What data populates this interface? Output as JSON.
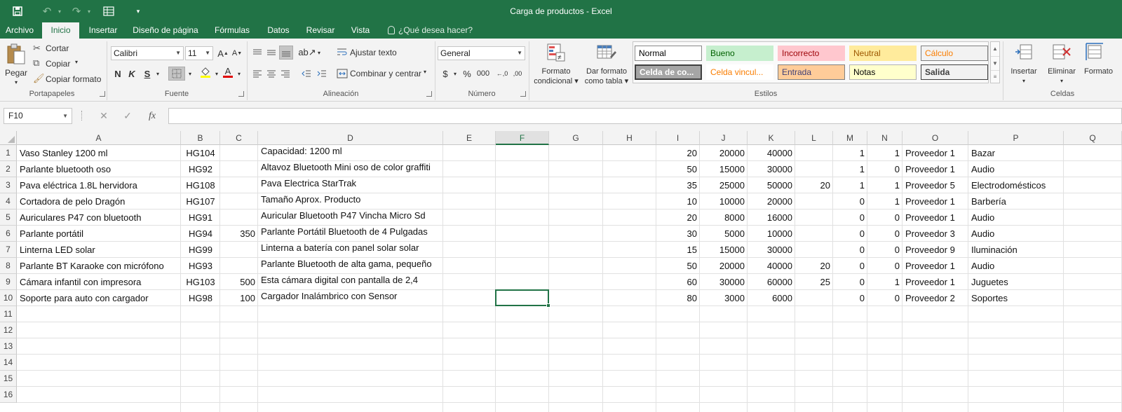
{
  "window_title": "Carga de productos - Excel",
  "quick_access": {
    "save_icon": "save-icon",
    "undo_icon": "undo-icon",
    "redo_icon": "redo-icon",
    "form_icon": "form-icon",
    "customize_icon": "customize-qat-icon"
  },
  "tabs": [
    {
      "label": "Archivo",
      "active": false
    },
    {
      "label": "Inicio",
      "active": true
    },
    {
      "label": "Insertar",
      "active": false
    },
    {
      "label": "Diseño de página",
      "active": false
    },
    {
      "label": "Fórmulas",
      "active": false
    },
    {
      "label": "Datos",
      "active": false
    },
    {
      "label": "Revisar",
      "active": false
    },
    {
      "label": "Vista",
      "active": false
    }
  ],
  "tell_me": "¿Qué desea hacer?",
  "ribbon": {
    "clipboard": {
      "paste": "Pegar",
      "cut": "Cortar",
      "copy": "Copiar",
      "format_painter": "Copiar formato",
      "group": "Portapapeles"
    },
    "font": {
      "name": "Calibri",
      "size": "11",
      "grow": "A",
      "shrink": "A",
      "bold": "N",
      "italic": "K",
      "underline": "S",
      "color_letter": "A",
      "group": "Fuente"
    },
    "alignment": {
      "wrap": "Ajustar texto",
      "merge": "Combinar y centrar",
      "group": "Alineación"
    },
    "number": {
      "format": "General",
      "currency": "$",
      "percent": "%",
      "thousands": "000",
      "inc_decimal": "←,0",
      "dec_decimal": ",00",
      "group": "Número"
    },
    "styles": {
      "conditional_line1": "Formato",
      "conditional_line2": "condicional",
      "table_line1": "Dar formato",
      "table_line2": "como tabla",
      "cells": [
        {
          "label": "Normal",
          "bg": "#ffffff",
          "fg": "#000000",
          "border": "#8a8a8a"
        },
        {
          "label": "Bueno",
          "bg": "#c6efce",
          "fg": "#006100",
          "border": "#c6efce"
        },
        {
          "label": "Incorrecto",
          "bg": "#ffc7ce",
          "fg": "#9c0006",
          "border": "#ffc7ce"
        },
        {
          "label": "Neutral",
          "bg": "#ffeb9c",
          "fg": "#9c5700",
          "border": "#ffeb9c"
        },
        {
          "label": "Cálculo",
          "bg": "#f2f2f2",
          "fg": "#fa7d00",
          "border": "#7f7f7f"
        },
        {
          "label": "Celda de co...",
          "bg": "#a5a5a5",
          "fg": "#ffffff",
          "border": "#3f3f3f"
        },
        {
          "label": "Celda vincul...",
          "bg": "#ffffff",
          "fg": "#fa7d00",
          "border": "#ffffff"
        },
        {
          "label": "Entrada",
          "bg": "#ffcc99",
          "fg": "#3f3f76",
          "border": "#7f7f7f"
        },
        {
          "label": "Notas",
          "bg": "#ffffcc",
          "fg": "#000000",
          "border": "#b2b2b2"
        },
        {
          "label": "Salida",
          "bg": "#f2f2f2",
          "fg": "#3f3f3f",
          "border": "#3f3f3f"
        }
      ],
      "group": "Estilos"
    },
    "cells": {
      "insert": "Insertar",
      "delete": "Eliminar",
      "format": "Formato",
      "group": "Celdas"
    }
  },
  "formula_bar": {
    "name_box": "F10",
    "cancel": "✕",
    "enter": "✓",
    "fx": "fx",
    "value": ""
  },
  "columns": [
    "A",
    "B",
    "C",
    "D",
    "E",
    "F",
    "G",
    "H",
    "I",
    "J",
    "K",
    "L",
    "M",
    "N",
    "O",
    "P",
    "Q"
  ],
  "selected_column": "F",
  "row_numbers": [
    "1",
    "2",
    "3",
    "4",
    "5",
    "6",
    "7",
    "8",
    "9",
    "10",
    "11",
    "12",
    "13",
    "14",
    "15",
    "16"
  ],
  "rows": [
    [
      "Vaso Stanley 1200 ml",
      "HG104",
      "",
      "Capacidad: 1200 ml",
      "",
      "",
      "",
      "",
      "20",
      "20000",
      "40000",
      "",
      "1",
      "1",
      "Proveedor 1",
      "Bazar"
    ],
    [
      "Parlante bluetooth oso",
      "HG92",
      "",
      "Altavoz Bluetooth Mini oso de color graffiti",
      "",
      "",
      "",
      "",
      "50",
      "15000",
      "30000",
      "",
      "1",
      "0",
      "Proveedor 1",
      "Audio"
    ],
    [
      "Pava eléctrica 1.8L hervidora",
      "HG108",
      "",
      "Pava Electrica StarTrak",
      "",
      "",
      "",
      "",
      "35",
      "25000",
      "50000",
      "20",
      "1",
      "1",
      "Proveedor 5",
      "Electrodomésticos"
    ],
    [
      "Cortadora de pelo Dragón",
      "HG107",
      "",
      "Tamaño Aprox. Producto",
      "",
      "",
      "",
      "",
      "10",
      "10000",
      "20000",
      "",
      "0",
      "1",
      "Proveedor 1",
      "Barbería"
    ],
    [
      "Auriculares P47 con bluetooth",
      "HG91",
      "",
      "Auricular Bluetooth P47 Vincha Micro Sd",
      "",
      "",
      "",
      "",
      "20",
      "8000",
      "16000",
      "",
      "0",
      "0",
      "Proveedor 1",
      "Audio"
    ],
    [
      "Parlante portátil",
      "HG94",
      "350",
      "Parlante Portátil Bluetooth de 4 Pulgadas",
      "",
      "",
      "",
      "",
      "30",
      "5000",
      "10000",
      "",
      "0",
      "0",
      "Proveedor 3",
      "Audio"
    ],
    [
      "Linterna LED solar",
      "HG99",
      "",
      "Linterna a batería con panel solar solar",
      "",
      "",
      "",
      "",
      "15",
      "15000",
      "30000",
      "",
      "0",
      "0",
      "Proveedor 9",
      "Iluminación"
    ],
    [
      "Parlante BT Karaoke con micrófono",
      "HG93",
      "",
      "Parlante Bluetooth de alta gama, pequeño",
      "",
      "",
      "",
      "",
      "50",
      "20000",
      "40000",
      "20",
      "0",
      "0",
      "Proveedor 1",
      "Audio"
    ],
    [
      "Cámara infantil con impresora",
      "HG103",
      "500",
      "Esta cámara digital con pantalla de 2,4",
      "",
      "",
      "",
      "",
      "60",
      "30000",
      "60000",
      "25",
      "0",
      "1",
      "Proveedor 1",
      "Juguetes"
    ],
    [
      "Soporte para auto con cargador",
      "HG98",
      "100",
      "Cargador Inalámbrico con Sensor",
      "",
      "",
      "",
      "",
      "80",
      "3000",
      "6000",
      "",
      "0",
      "0",
      "Proveedor 2",
      "Soportes"
    ]
  ]
}
